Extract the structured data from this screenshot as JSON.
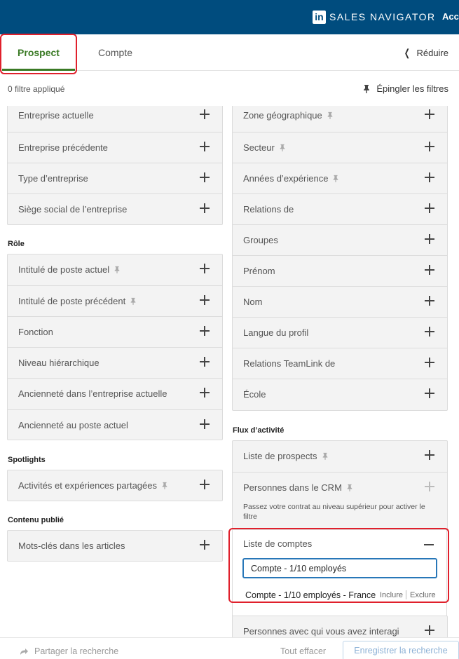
{
  "header": {
    "logo_text": "in",
    "brand": "SALES NAVIGATOR",
    "account_fragment": "Acc",
    "bg_color": "#004c7e"
  },
  "tabs": {
    "prospect": "Prospect",
    "compte": "Compte",
    "reduce": "Réduire",
    "active_color": "#3a7a25"
  },
  "filter_bar": {
    "count": "0 filtre appliqué",
    "pin_filters": "Épingler les filtres"
  },
  "left_column": {
    "entreprise": [
      {
        "label": "Entreprise actuelle"
      },
      {
        "label": "Entreprise précédente"
      },
      {
        "label": "Type d’entreprise"
      },
      {
        "label": "Siège social de l’entreprise"
      }
    ],
    "role_title": "Rôle",
    "role": [
      {
        "label": "Intitulé de poste actuel",
        "pinned": true
      },
      {
        "label": "Intitulé de poste précédent",
        "pinned": true
      },
      {
        "label": "Fonction"
      },
      {
        "label": "Niveau hiérarchique"
      },
      {
        "label": "Ancienneté dans l’entreprise actuelle"
      },
      {
        "label": "Ancienneté au poste actuel"
      }
    ],
    "spotlights_title": "Spotlights",
    "spotlights": [
      {
        "label": "Activités et expériences partagées",
        "pinned": true
      }
    ],
    "contenu_title": "Contenu publié",
    "contenu": [
      {
        "label": "Mots-clés dans les articles"
      }
    ]
  },
  "right_column": {
    "personal": [
      {
        "label": "Zone géographique",
        "pinned": true
      },
      {
        "label": "Secteur",
        "pinned": true
      },
      {
        "label": "Années d’expérience",
        "pinned": true
      },
      {
        "label": "Relations de"
      },
      {
        "label": "Groupes"
      },
      {
        "label": "Prénom"
      },
      {
        "label": "Nom"
      },
      {
        "label": "Langue du profil"
      },
      {
        "label": "Relations TeamLink de"
      },
      {
        "label": "École"
      }
    ],
    "flux_title": "Flux d’activité",
    "flux": {
      "liste_prospects": "Liste de prospects",
      "crm_label": "Personnes dans le CRM",
      "crm_note": "Passez votre contrat au niveau supérieur pour activer le filtre",
      "liste_comptes": "Liste de comptes",
      "search_value": "Compte - 1/10 employés",
      "suggestion": "Compte - 1/10 employés - France",
      "include": "Inclure",
      "exclude": "Exclure",
      "next_row_partial": "Personnes avec qui vous avez interagi"
    }
  },
  "bottom_bar": {
    "share": "Partager la recherche",
    "clear_all": "Tout effacer",
    "save": "Enregistrer la recherche"
  },
  "colors": {
    "annotation": "#e0202c",
    "input_focus": "#2877b8"
  }
}
